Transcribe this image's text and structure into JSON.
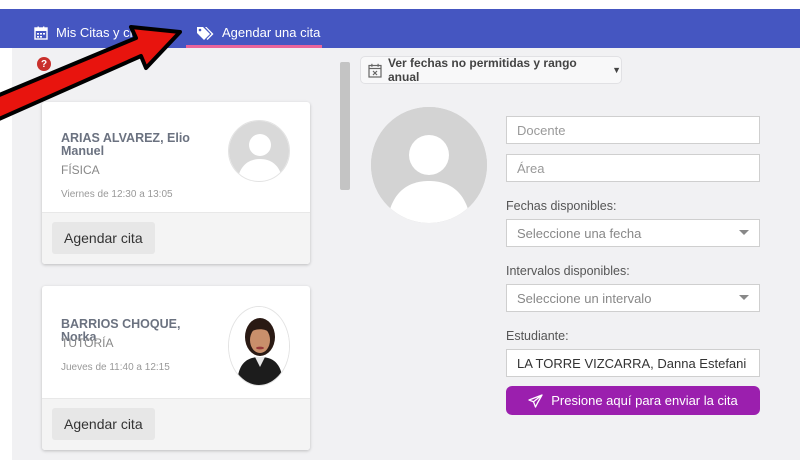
{
  "nav": {
    "tabs": [
      {
        "label": "Mis Citas y citas"
      },
      {
        "label": "Agendar una cita"
      }
    ],
    "active_tab": "Agendar una cita"
  },
  "teachers": [
    {
      "name": "ARIAS ALVAREZ, Elio Manuel",
      "subject": "FÍSICA",
      "schedule": "Viernes de 12:30 a 13:05",
      "button_label": "Agendar cita"
    },
    {
      "name": "BARRIOS CHOQUE, Norka",
      "subject": "TUTORÍA",
      "schedule": "Jueves de 11:40 a 12:15",
      "button_label": "Agendar cita"
    }
  ],
  "form": {
    "fechas_button_label": "Ver fechas no permitidas y rango anual",
    "docente_placeholder": "Docente",
    "area_placeholder": "Área",
    "fechas_label": "Fechas disponibles:",
    "fechas_select": "Seleccione una fecha",
    "intervalos_label": "Intervalos disponibles:",
    "intervalos_select": "Seleccione un intervalo",
    "estudiante_label": "Estudiante:",
    "estudiante_value": "LA TORRE VIZCARRA, Danna Estefani",
    "send_label": "Presione aquí para enviar la cita"
  },
  "icons": {
    "calendar": "calendar-icon",
    "tags": "tags-icon",
    "help": "question-circle-icon",
    "calendar_times": "calendar-times-icon",
    "send": "paper-plane-icon"
  },
  "colors": {
    "navbar": "#4556c1",
    "tab_underline": "#e9649a",
    "send_button": "#9b1fae",
    "annotation_arrow": "#e8140e"
  }
}
